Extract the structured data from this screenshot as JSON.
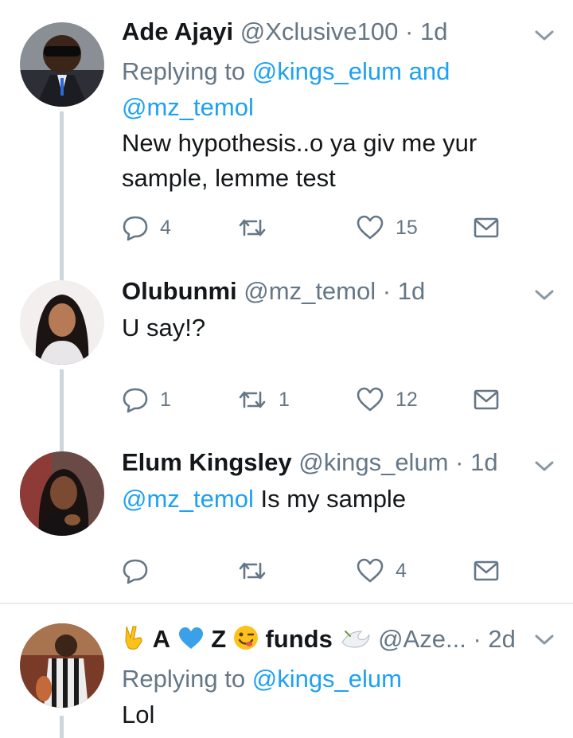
{
  "tweets": [
    {
      "name": "Ade Ajayi",
      "handle": "@Xclusive100",
      "dot": "·",
      "time": "1d",
      "reply_prefix": "Replying to",
      "reply_mentions": "@kings_elum and",
      "reply_mentions_line2": "@mz_temol",
      "text": "New hypothesis..o ya giv me yur sample, lemme test",
      "replies": "4",
      "retweets": "",
      "likes": "15"
    },
    {
      "name": "Olubunmi",
      "handle": "@mz_temol",
      "dot": "·",
      "time": "1d",
      "text": "U say!?",
      "replies": "1",
      "retweets": "1",
      "likes": "12"
    },
    {
      "name": "Elum Kingsley",
      "handle": "@kings_elum",
      "dot": "·",
      "time": "1d",
      "mention": "@mz_temol",
      "text": "Is my sample",
      "replies": "",
      "retweets": "",
      "likes": "4"
    },
    {
      "name_a": "A",
      "name_z": "Z",
      "name_funds": "funds",
      "handle": "@Aze...",
      "dot": "·",
      "time": "2d",
      "reply_prefix": "Replying to",
      "reply_mentions": "@kings_elum",
      "text": "Lol"
    }
  ],
  "colors": {
    "text": "#14171a",
    "secondary": "#657786",
    "mention": "#1da1f2",
    "thread_line": "#ccd6dd",
    "separator": "#e6ecf0"
  },
  "icons": {
    "reply": "reply-icon",
    "retweet": "retweet-icon",
    "like": "heart-icon",
    "dm": "envelope-icon",
    "menu": "chevron-down-icon"
  }
}
